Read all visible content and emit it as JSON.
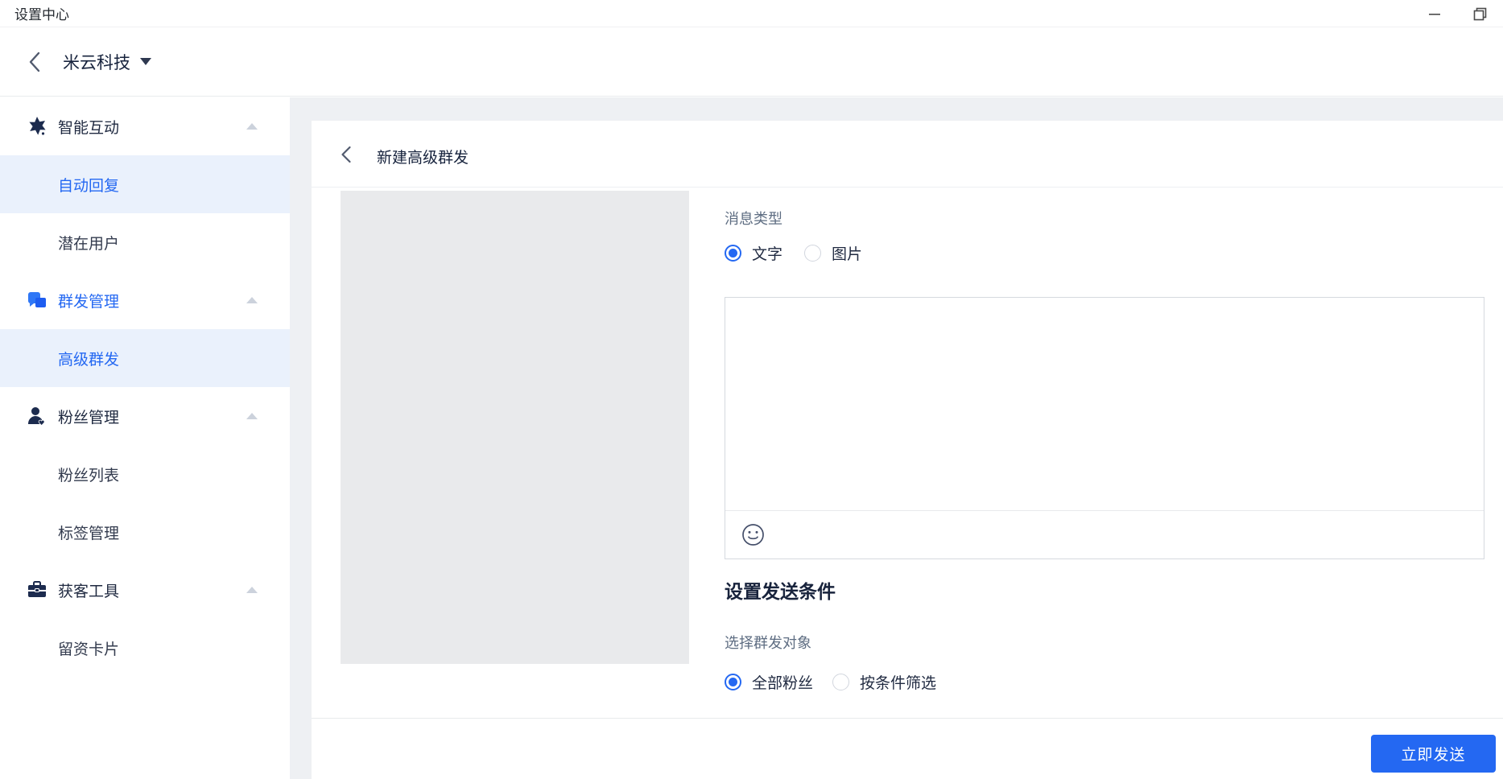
{
  "window": {
    "title": "设置中心",
    "controls": {
      "minimize": "minimize",
      "restore": "restore-down"
    }
  },
  "header": {
    "back_icon": "chevron-left",
    "account_name": "米云科技",
    "dropdown_icon": "caret-down"
  },
  "sidebar": {
    "items": [
      {
        "label": "智能互动",
        "type": "parent",
        "icon": "spark-icon",
        "expanded": true
      },
      {
        "label": "自动回复",
        "type": "child",
        "active": true
      },
      {
        "label": "潜在用户",
        "type": "child",
        "active": false
      },
      {
        "label": "群发管理",
        "type": "parent",
        "icon": "chat-bubbles-icon",
        "expanded": true,
        "highlighted": true
      },
      {
        "label": "高级群发",
        "type": "child",
        "active": true
      },
      {
        "label": "粉丝管理",
        "type": "parent",
        "icon": "fan-user-icon",
        "expanded": true
      },
      {
        "label": "粉丝列表",
        "type": "child",
        "active": false
      },
      {
        "label": "标签管理",
        "type": "child",
        "active": false
      },
      {
        "label": "获客工具",
        "type": "parent",
        "icon": "toolbox-icon",
        "expanded": true
      },
      {
        "label": "留资卡片",
        "type": "child",
        "active": false
      }
    ]
  },
  "main": {
    "page_title": "新建高级群发",
    "message_type": {
      "label": "消息类型",
      "option1": {
        "label": "文字",
        "selected": true
      },
      "option2": {
        "label": "图片",
        "selected": false
      }
    },
    "editor": {
      "value": "",
      "toolbar_icons": [
        "emoji-icon"
      ]
    },
    "send_condition": {
      "heading": "设置发送条件",
      "target_label": "选择群发对象",
      "option1": {
        "label": "全部粉丝",
        "selected": true
      },
      "option2": {
        "label": "按条件筛选",
        "selected": false
      }
    },
    "send_button_label": "立即发送"
  },
  "colors": {
    "accent_blue": "#2468f2",
    "sidebar_active_bg": "#eaf1fc",
    "content_bg": "#eef0f3",
    "preview_bg": "#e9eaec",
    "dark_text": "#17233d",
    "gray_label": "#5e6d82",
    "icon_navy": "#1c2b4e"
  }
}
